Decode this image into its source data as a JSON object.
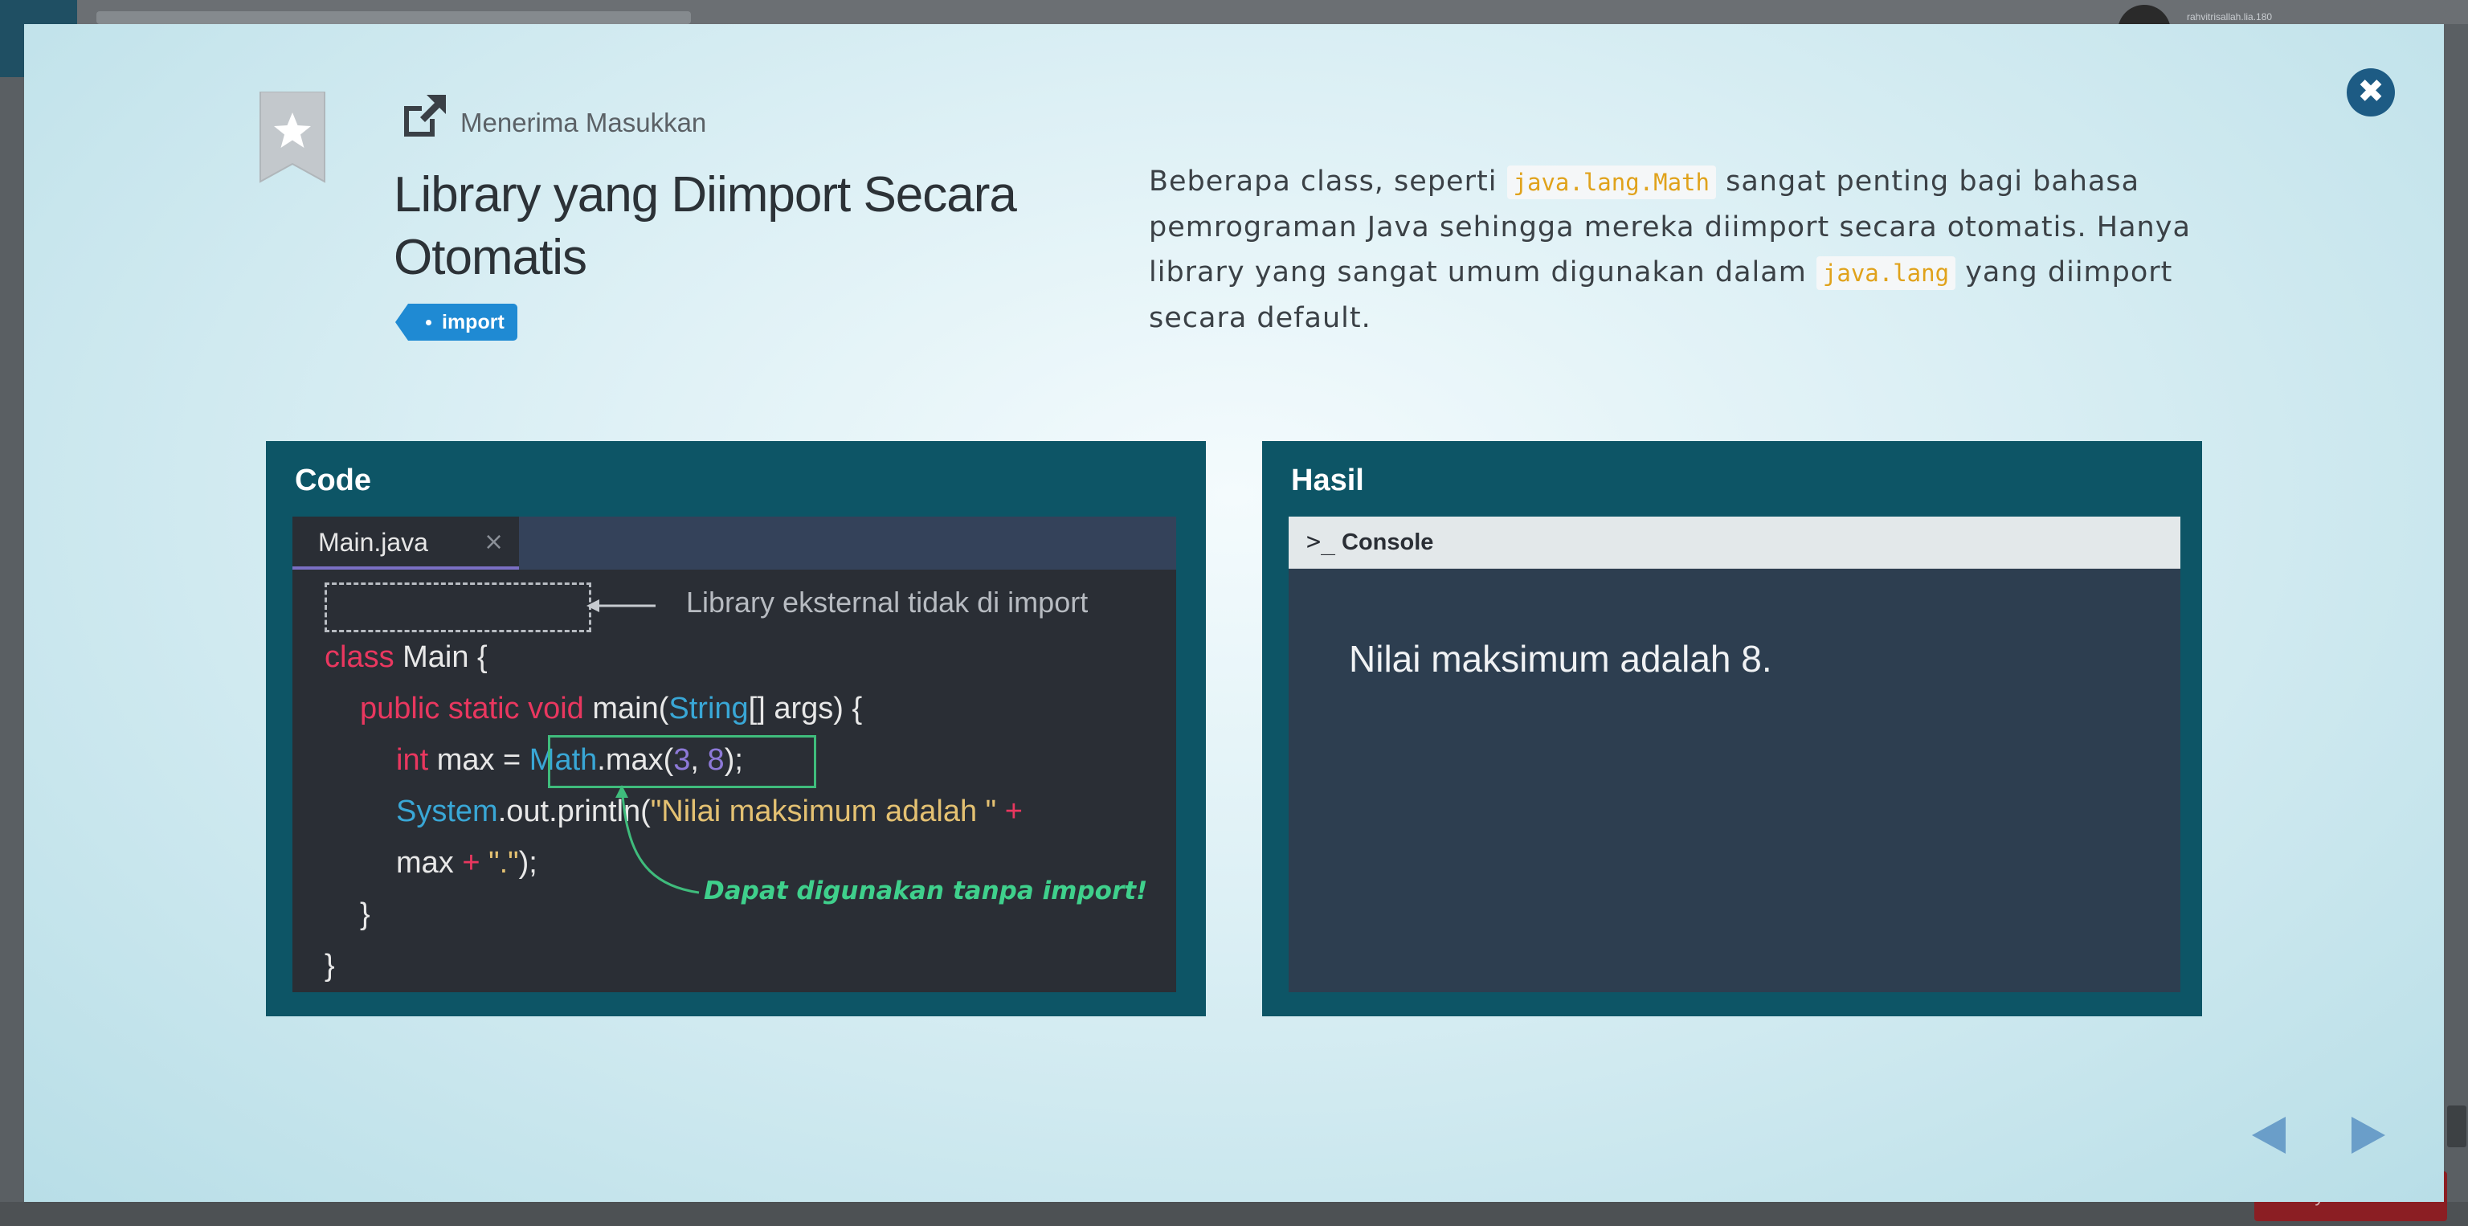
{
  "background": {
    "username": "rahvitrisallah.lia.180"
  },
  "bottom_button": {
    "label": "Tanya"
  },
  "close": {
    "glyph": "✖"
  },
  "header": {
    "subtitle": "Menerima Masukkan",
    "title": "Library yang Diimport Secara Otomatis",
    "tag": "import"
  },
  "description": {
    "part1": "Beberapa class, seperti ",
    "code1": "java.lang.Math",
    "part2": " sangat penting bagi bahasa pemrograman Java sehingga mereka diimport secara otomatis. Hanya library yang sangat umum digunakan dalam ",
    "code2": "java.lang",
    "part3": " yang diimport secara default."
  },
  "code_panel": {
    "title": "Code",
    "tab_label": "Main.java",
    "tab_close": "×",
    "annotation_top": "Library eksternal tidak di import",
    "annotation_bottom": "Dapat digunakan tanpa import!",
    "lines": {
      "l1_kw": "class",
      "l1_rest": " Main {",
      "l2_kw": "public static void",
      "l2_a": " main(",
      "l2_ty": "String",
      "l2_b": "[] args) {",
      "l3_kw": "int",
      "l3_a": " max = ",
      "l3_ty": "Math",
      "l3_b": ".max(",
      "l3_n1": "3",
      "l3_c": ", ",
      "l3_n2": "8",
      "l3_d": ");",
      "l4_ty": "System",
      "l4_a": ".out.println(",
      "l4_str": "\"Nilai maksimum adalah \"",
      "l4_op": " +",
      "l5_a": "max ",
      "l5_op": "+",
      "l5_str": " \".\"",
      "l5_b": ");",
      "l6": "}",
      "l7": "}"
    }
  },
  "result_panel": {
    "title": "Hasil",
    "console_prompt": ">_",
    "console_label": "Console",
    "output": "Nilai maksimum adalah 8."
  },
  "colors": {
    "panel_bg": "#0d5566",
    "editor_bg": "#2a2e35",
    "console_bg": "#2d3e50",
    "tag_bg": "#1f8ad3",
    "keyword": "#e9375f",
    "type": "#39a7d6",
    "number": "#8d79d8",
    "string": "#e4c172",
    "annotation_green": "#3fd08c",
    "code_inline": "#e0a21b",
    "close_bg": "#1d5b84",
    "nav_arrow": "#6a9ec9"
  },
  "icons": {
    "bookmark": "bookmark-star-icon",
    "external": "external-link-icon",
    "close": "close-icon",
    "prev": "triangle-left-icon",
    "next": "triangle-right-icon"
  }
}
